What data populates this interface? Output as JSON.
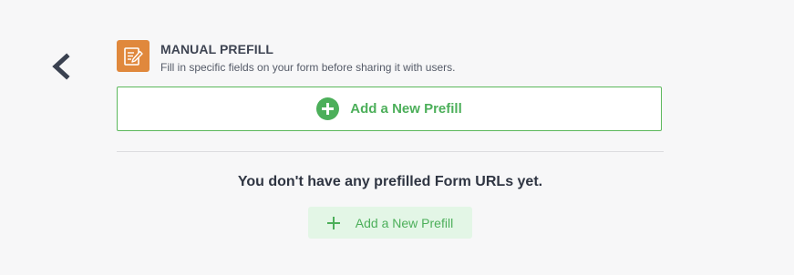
{
  "header": {
    "icon": "edit-form-icon",
    "title": "MANUAL PREFILL",
    "description": "Fill in specific fields on your form before sharing it with users."
  },
  "back_button": {
    "icon": "chevron-left-icon"
  },
  "primary_action": {
    "label": "Add a New Prefill",
    "icon": "plus-circle-icon"
  },
  "empty_state": {
    "message": "You don't have any prefilled Form URLs yet.",
    "button_label": "Add a New Prefill",
    "button_icon": "plus-icon"
  },
  "colors": {
    "accent_green": "#4caf5a",
    "icon_orange": "#e0883c",
    "light_green_bg": "#e3f6e6"
  }
}
